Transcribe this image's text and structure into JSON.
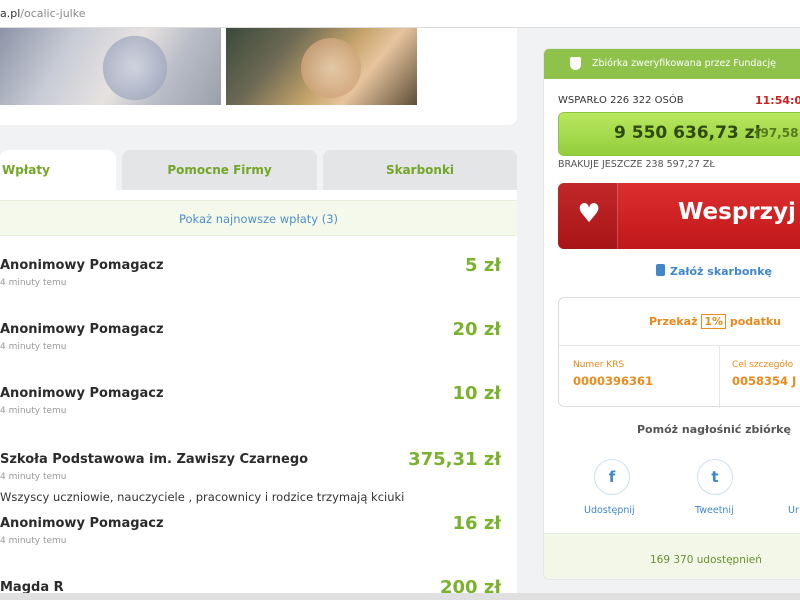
{
  "browser": {
    "url_domain": "a.pl",
    "url_path": "/ocalic-julke"
  },
  "tabs": [
    {
      "label": "Wpłaty"
    },
    {
      "label": "Pomocne Firmy"
    },
    {
      "label": "Skarbonki"
    }
  ],
  "donations": {
    "show_newest": "Pokaż najnowsze wpłaty (3)",
    "items": [
      {
        "name": "Anonimowy Pomagacz",
        "time": "4 minuty temu",
        "amount": "5 zł"
      },
      {
        "name": "Anonimowy Pomagacz",
        "time": "4 minuty temu",
        "amount": "20 zł"
      },
      {
        "name": "Anonimowy Pomagacz",
        "time": "4 minuty temu",
        "amount": "10 zł"
      },
      {
        "name": "Szkoła Podstawowa im. Zawiszy Czarnego",
        "time": "4 minuty temu",
        "amount": "375,31 zł",
        "message": "Wszyscy uczniowie, nauczyciele , pracownicy i rodzice trzymają kciuki"
      },
      {
        "name": "Anonimowy Pomagacz",
        "time": "4 minuty temu",
        "amount": "16 zł"
      },
      {
        "name": "Magda R",
        "time": "",
        "amount": "200 zł"
      }
    ]
  },
  "fundraiser": {
    "verified_text": "Zbiórka zweryfikowana przez Fundację",
    "supporters": "WSPARŁO 226 322 OSÓB",
    "timer": "11:54:0",
    "raised": "9 550 636,73 zł",
    "percent_text": "(97,58",
    "percent_value": 97.58,
    "missing": "BRAKUJE JESZCZE 238 597,27 ZŁ",
    "donate_label": "Wesprzyj",
    "piggy_label": "Załóż skarbonkę",
    "tax": {
      "prefix": "Przekaż",
      "one_percent": "1%",
      "suffix": "podatku",
      "krs_label": "Numer KRS",
      "krs_value": "0000396361",
      "goal_label": "Cel szczegóło",
      "goal_value": "0058354 J"
    },
    "share_heading": "Pomóż nagłośnić zbiórkę",
    "share_buttons": [
      {
        "icon": "facebook-icon",
        "glyph": "f",
        "label": "Udostępnij"
      },
      {
        "icon": "twitter-icon",
        "glyph": "t",
        "label": "Tweetnij"
      },
      {
        "label": "Ur"
      }
    ],
    "share_count": "169 370 udostępnień"
  },
  "colors": {
    "green": "#7ab12d",
    "red": "#d0201e",
    "orange": "#e88a1c",
    "blue": "#3f87c8"
  }
}
